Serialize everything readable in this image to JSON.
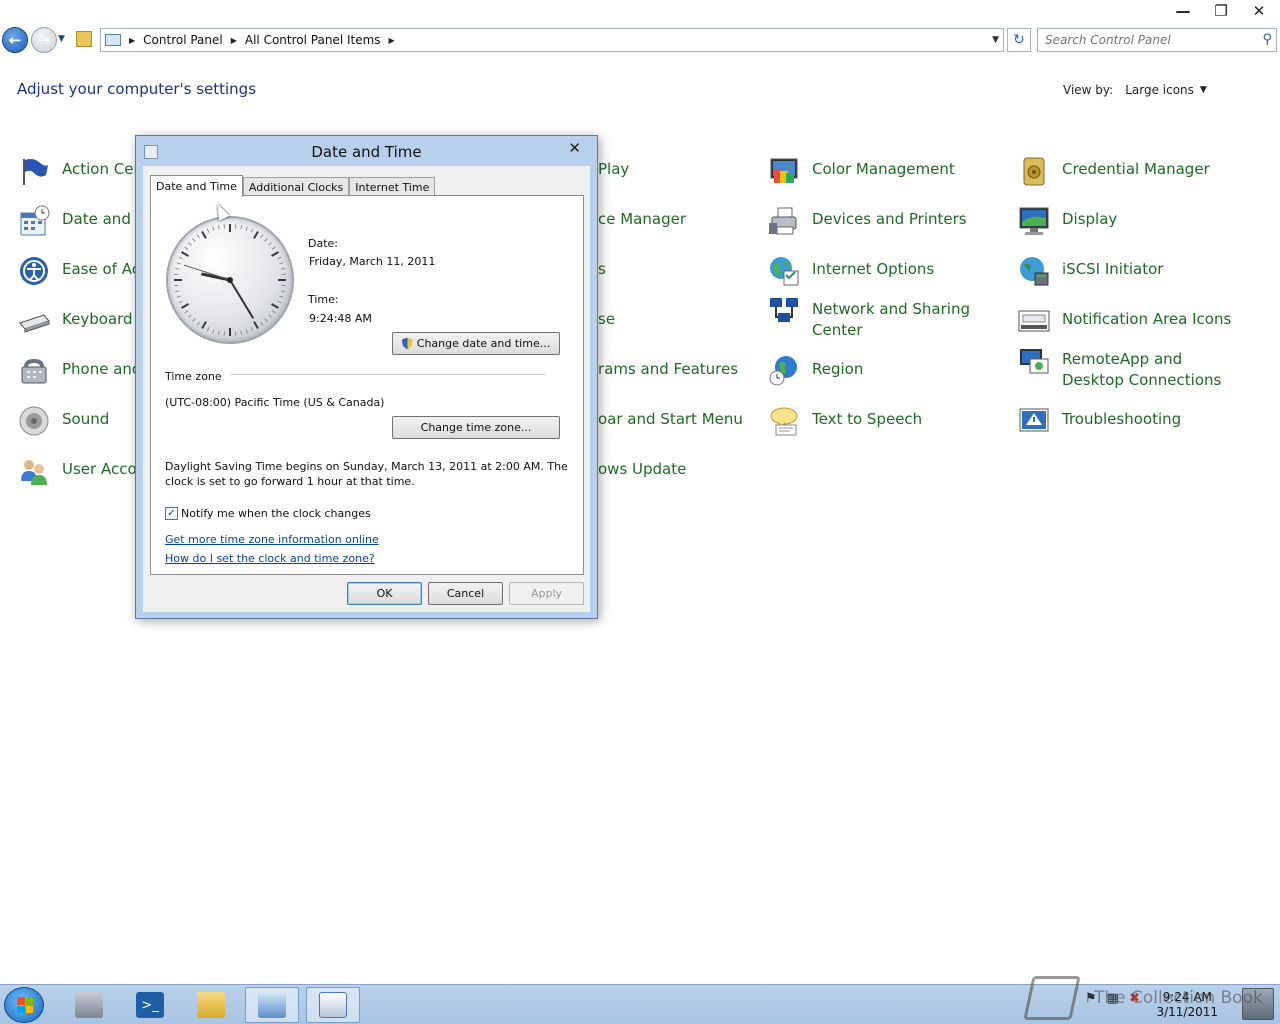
{
  "address_bar": {
    "crumbs": [
      "Control Panel",
      "All Control Panel Items"
    ],
    "search_placeholder": "Search Control Panel"
  },
  "page": {
    "heading": "Adjust your computer's settings",
    "view_by_label": "View by:",
    "view_by_value": "Large icons"
  },
  "items": [
    {
      "label": "Action Center",
      "visible_label": "Action Cen",
      "icon": "flag-icon",
      "color": "#2d53b5"
    },
    {
      "label": "Date and Time",
      "visible_label": "Date and T",
      "icon": "calendar-clock-icon",
      "color": "#4a78b8"
    },
    {
      "label": "Ease of Access Center",
      "visible_label": "Ease of Acc",
      "icon": "ease-of-access-icon",
      "color": "#2a5fb0"
    },
    {
      "label": "Keyboard",
      "visible_label": "Keyboard",
      "icon": "keyboard-icon",
      "color": "#7a7a7a"
    },
    {
      "label": "Phone and Modem",
      "visible_label": "Phone and",
      "icon": "phone-icon",
      "color": "#6b7280"
    },
    {
      "label": "Sound",
      "visible_label": "Sound",
      "icon": "speaker-icon",
      "color": "#9a9a9a"
    },
    {
      "label": "User Accounts",
      "visible_label": "User Accou",
      "icon": "users-icon",
      "color": "#3f7ad0"
    },
    {
      "label": "AutoPlay",
      "visible_label": "Play",
      "icon": "autoplay-icon",
      "color": "#4caf50"
    },
    {
      "label": "Device Manager",
      "visible_label": "ce Manager",
      "icon": "device-manager-icon",
      "color": "#6b7280"
    },
    {
      "label": "Fonts",
      "visible_label": "s",
      "icon": "fonts-icon",
      "color": "#d0a020"
    },
    {
      "label": "Mouse",
      "visible_label": "se",
      "icon": "mouse-icon",
      "color": "#8a8a8a"
    },
    {
      "label": "Programs and Features",
      "visible_label": "rams and Features",
      "icon": "programs-icon",
      "color": "#3a74c4"
    },
    {
      "label": "Taskbar and Start Menu",
      "visible_label": "oar and Start Menu",
      "icon": "taskbar-icon",
      "color": "#3a74c4"
    },
    {
      "label": "Windows Update",
      "visible_label": "ows Update",
      "icon": "update-icon",
      "color": "#2d8f3a"
    },
    {
      "label": "Color Management",
      "visible_label": "Color Management",
      "icon": "color-management-icon",
      "color": "#c0392b"
    },
    {
      "label": "Devices and Printers",
      "visible_label": "Devices and Printers",
      "icon": "printer-icon",
      "color": "#7a7a7a"
    },
    {
      "label": "Internet Options",
      "visible_label": "Internet Options",
      "icon": "globe-icon",
      "color": "#2e8b57"
    },
    {
      "label": "Network and Sharing Center",
      "visible_label": "Network and Sharing Center",
      "icon": "network-icon",
      "color": "#1d4fa0"
    },
    {
      "label": "Region",
      "visible_label": "Region",
      "icon": "region-globe-icon",
      "color": "#2e7bcf"
    },
    {
      "label": "Text to Speech",
      "visible_label": "Text to Speech",
      "icon": "speech-bubble-icon",
      "color": "#e6c650"
    },
    {
      "label": "Credential Manager",
      "visible_label": "Credential Manager",
      "icon": "vault-icon",
      "color": "#b8962e"
    },
    {
      "label": "Display",
      "visible_label": "Display",
      "icon": "monitor-icon",
      "color": "#2c6fbe"
    },
    {
      "label": "iSCSI Initiator",
      "visible_label": "iSCSI Initiator",
      "icon": "iscsi-icon",
      "color": "#3c8c3c"
    },
    {
      "label": "Notification Area Icons",
      "visible_label": "Notification Area Icons",
      "icon": "notification-area-icon",
      "color": "#555555"
    },
    {
      "label": "RemoteApp and Desktop Connections",
      "visible_label": "RemoteApp and Desktop Connections",
      "icon": "remote-desktop-icon",
      "color": "#2c6fbe"
    },
    {
      "label": "Troubleshooting",
      "visible_label": "Troubleshooting",
      "icon": "troubleshoot-icon",
      "color": "#2c6fbe"
    }
  ],
  "dialog": {
    "title": "Date and Time",
    "tabs": [
      "Date and Time",
      "Additional Clocks",
      "Internet Time"
    ],
    "active_tab": 0,
    "date_label": "Date:",
    "date_value": "Friday, March 11, 2011",
    "time_label": "Time:",
    "time_value": "9:24:48 AM",
    "change_datetime_button": "Change date and time...",
    "timezone_group": "Time zone",
    "timezone_value": "(UTC-08:00) Pacific Time (US & Canada)",
    "change_timezone_button": "Change time zone...",
    "dst_line1": "Daylight Saving Time begins on Sunday, March 13, 2011 at 2:00 AM. The",
    "dst_line2": "clock is set to go forward 1 hour at that time.",
    "notify_label": "Notify me when the clock changes",
    "notify_checked": true,
    "link_more_info": "Get more time zone information online",
    "link_how_to": "How do I set the clock and time zone?",
    "ok_button": "OK",
    "cancel_button": "Cancel",
    "apply_button": "Apply"
  },
  "taskbar": {
    "clock_time": "9:24 AM",
    "clock_date": "3/11/2011",
    "watermark": "The Collection Book"
  }
}
